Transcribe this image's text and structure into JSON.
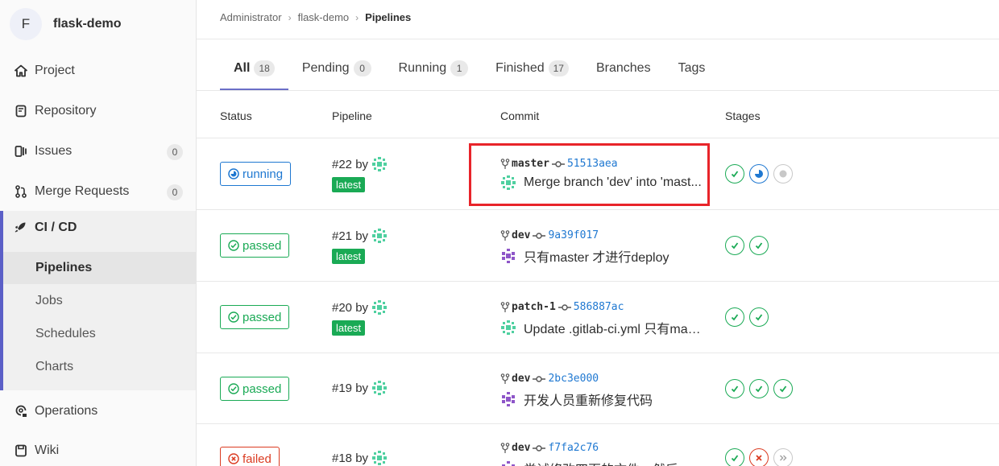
{
  "project": {
    "avatar_letter": "F",
    "name": "flask-demo"
  },
  "sidebar": {
    "items": [
      {
        "label": "Project",
        "icon": "home-icon"
      },
      {
        "label": "Repository",
        "icon": "repository-icon"
      },
      {
        "label": "Issues",
        "icon": "issues-icon",
        "count": "0"
      },
      {
        "label": "Merge Requests",
        "icon": "merge-request-icon",
        "count": "0"
      }
    ],
    "cicd": {
      "label": "CI / CD",
      "icon": "rocket-icon",
      "subitems": [
        "Pipelines",
        "Jobs",
        "Schedules",
        "Charts"
      ],
      "active": "Pipelines"
    },
    "bottom_items": [
      {
        "label": "Operations",
        "icon": "operations-icon"
      },
      {
        "label": "Wiki",
        "icon": "wiki-icon"
      }
    ]
  },
  "breadcrumb": {
    "items": [
      "Administrator",
      "flask-demo"
    ],
    "current": "Pipelines"
  },
  "tabs": [
    {
      "label": "All",
      "count": "18",
      "active": true
    },
    {
      "label": "Pending",
      "count": "0"
    },
    {
      "label": "Running",
      "count": "1"
    },
    {
      "label": "Finished",
      "count": "17"
    },
    {
      "label": "Branches"
    },
    {
      "label": "Tags"
    }
  ],
  "table": {
    "headers": {
      "status": "Status",
      "pipeline": "Pipeline",
      "commit": "Commit",
      "stages": "Stages"
    },
    "rows": [
      {
        "status": "running",
        "id": "#22 by",
        "latest": "latest",
        "branch": "master",
        "sha": "51513aea",
        "message": "Merge branch 'dev' into 'mast...",
        "stages": [
          "success",
          "running",
          "created"
        ]
      },
      {
        "status": "passed",
        "id": "#21 by",
        "latest": "latest",
        "branch": "dev",
        "sha": "9a39f017",
        "message": "只有master 才进行deploy",
        "stages": [
          "success",
          "success"
        ]
      },
      {
        "status": "passed",
        "id": "#20 by",
        "latest": "latest",
        "branch": "patch-1",
        "sha": "586887ac",
        "message": "Update .gitlab-ci.yml 只有mas...",
        "stages": [
          "success",
          "success"
        ]
      },
      {
        "status": "passed",
        "id": "#19 by",
        "branch": "dev",
        "sha": "2bc3e000",
        "message": "开发人员重新修复代码",
        "stages": [
          "success",
          "success",
          "success"
        ]
      },
      {
        "status": "failed",
        "id": "#18 by",
        "branch": "dev",
        "sha": "f7fa2c76",
        "message": "尝试修改四页的文件，然后",
        "stages": [
          "success",
          "failed",
          "skipped"
        ]
      }
    ]
  },
  "colors": {
    "success": "#1aaa55",
    "running": "#1f78d1",
    "failed": "#db3b21",
    "accent": "#6b6fc7",
    "highlight": "#e8242a"
  }
}
